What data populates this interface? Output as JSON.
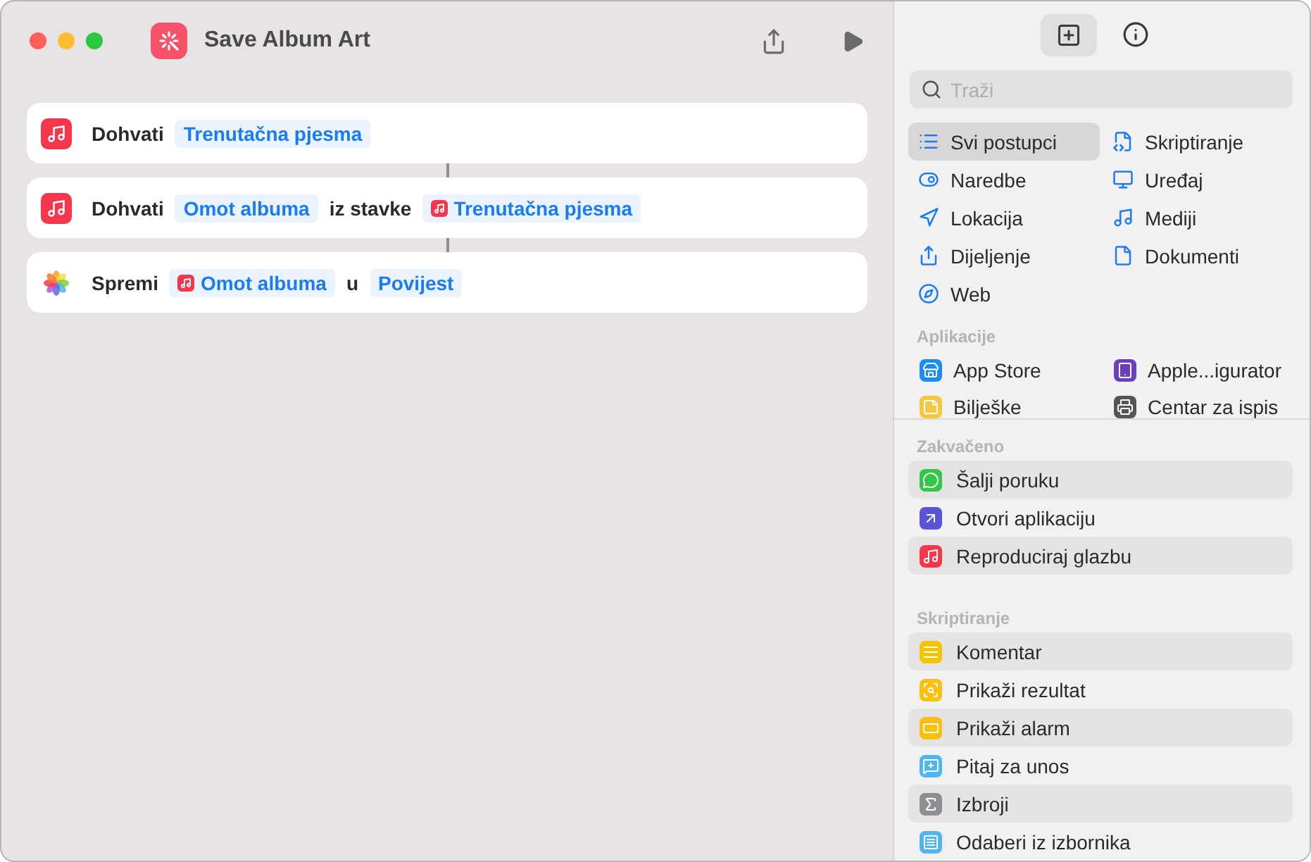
{
  "window": {
    "title": "Save Album Art"
  },
  "actions": [
    {
      "kind": "music",
      "parts": [
        {
          "kind": "text",
          "text": "Dohvati"
        },
        {
          "kind": "token",
          "text": "Trenutačna pjesma"
        }
      ]
    },
    {
      "kind": "music",
      "parts": [
        {
          "kind": "text",
          "text": "Dohvati"
        },
        {
          "kind": "token",
          "text": "Omot albuma"
        },
        {
          "kind": "text",
          "text": "iz stavke"
        },
        {
          "kind": "variable",
          "text": "Trenutačna pjesma"
        }
      ]
    },
    {
      "kind": "photos",
      "parts": [
        {
          "kind": "text",
          "text": "Spremi"
        },
        {
          "kind": "variable",
          "text": "Omot albuma"
        },
        {
          "kind": "text",
          "text": "u"
        },
        {
          "kind": "token",
          "text": "Povijest"
        }
      ]
    }
  ],
  "sidebar": {
    "tabs": [
      {
        "kind": "library",
        "selected": true
      },
      {
        "kind": "info",
        "selected": false
      }
    ],
    "search": {
      "placeholder": "Traži"
    },
    "categories": [
      {
        "label": "Svi postupci",
        "selected": true
      },
      {
        "label": "Skriptiranje",
        "selected": false
      },
      {
        "label": "Naredbe",
        "selected": false
      },
      {
        "label": "Uređaj",
        "selected": false
      },
      {
        "label": "Lokacija",
        "selected": false
      },
      {
        "label": "Mediji",
        "selected": false
      },
      {
        "label": "Dijeljenje",
        "selected": false
      },
      {
        "label": "Dokumenti",
        "selected": false
      },
      {
        "label": "Web",
        "selected": false
      }
    ],
    "apps_heading": "Aplikacije",
    "apps": [
      {
        "label": "App Store",
        "color": "#1a8cf5"
      },
      {
        "label": "Apple...igurator",
        "color": "#6a3fc0"
      },
      {
        "label": "Bilješke",
        "color": "#f5c842"
      },
      {
        "label": "Centar za ispis",
        "color": "#555555"
      }
    ],
    "sections": [
      {
        "heading": "Zakvačeno",
        "items": [
          {
            "label": "Šalji poruku",
            "color": "#33c748"
          },
          {
            "label": "Otvori aplikaciju",
            "color": "#5856d6"
          },
          {
            "label": "Reproduciraj glazbu",
            "color": "#f5364d"
          }
        ]
      },
      {
        "heading": "Skriptiranje",
        "items": [
          {
            "label": "Komentar",
            "color": "#f5c400"
          },
          {
            "label": "Prikaži rezultat",
            "color": "#fbbf10"
          },
          {
            "label": "Prikaži alarm",
            "color": "#fbbf10"
          },
          {
            "label": "Pitaj za unos",
            "color": "#4fb6f0"
          },
          {
            "label": "Izbroji",
            "color": "#8e8e93"
          },
          {
            "label": "Odaberi iz izbornika",
            "color": "#4fb6f0"
          }
        ]
      }
    ]
  }
}
